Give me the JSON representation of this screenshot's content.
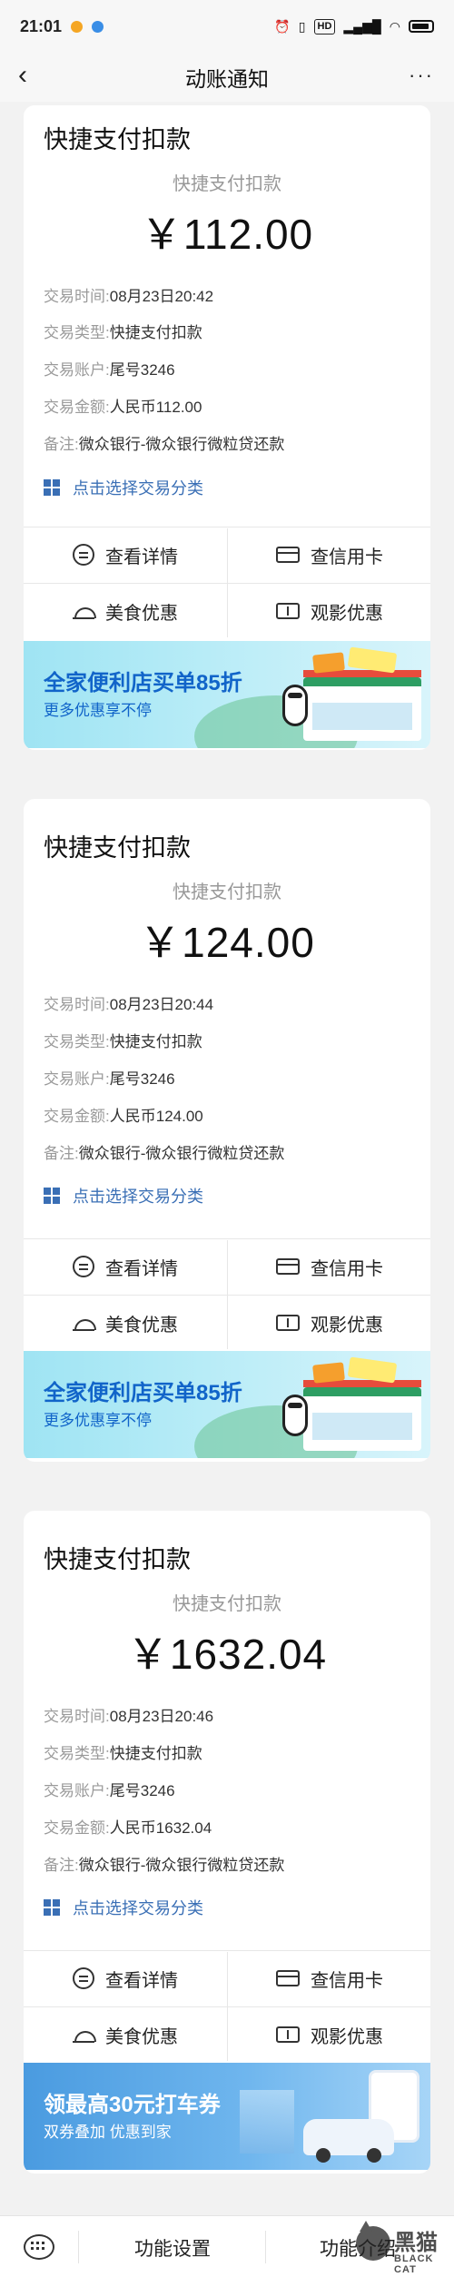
{
  "status_bar": {
    "time": "21:01",
    "icons": [
      "signal-icon",
      "wifi-icon",
      "battery-icon"
    ],
    "hd_label": "HD"
  },
  "nav": {
    "title": "动账通知",
    "back_icon": "‹",
    "more_icon": "···"
  },
  "labels": {
    "time": "交易时间:",
    "type": "交易类型:",
    "account": "交易账户:",
    "amount": "交易金额:",
    "remark": "备注:"
  },
  "cards": [
    {
      "title": "快捷支付扣款",
      "subtitle": "快捷支付扣款",
      "amount": "￥112.00",
      "time": "08月23日20:42",
      "type": "快捷支付扣款",
      "account": "尾号3246",
      "amount_detail": "人民币112.00",
      "remark": "微众银行-微众银行微粒贷还款",
      "classify": "点击选择交易分类",
      "actions": [
        "查看详情",
        "查信用卡",
        "美食优惠",
        "观影优惠"
      ],
      "banner": {
        "title": "全家便利店买单85折",
        "subtitle": "更多优惠享不停"
      }
    },
    {
      "title": "快捷支付扣款",
      "subtitle": "快捷支付扣款",
      "amount": "￥124.00",
      "time": "08月23日20:44",
      "type": "快捷支付扣款",
      "account": "尾号3246",
      "amount_detail": "人民币124.00",
      "remark": "微众银行-微众银行微粒贷还款",
      "classify": "点击选择交易分类",
      "actions": [
        "查看详情",
        "查信用卡",
        "美食优惠",
        "观影优惠"
      ],
      "banner": {
        "title": "全家便利店买单85折",
        "subtitle": "更多优惠享不停"
      }
    },
    {
      "title": "快捷支付扣款",
      "subtitle": "快捷支付扣款",
      "amount": "￥1632.04",
      "time": "08月23日20:46",
      "type": "快捷支付扣款",
      "account": "尾号3246",
      "amount_detail": "人民币1632.04",
      "remark": "微众银行-微众银行微粒贷还款",
      "classify": "点击选择交易分类",
      "actions": [
        "查看详情",
        "查信用卡",
        "美食优惠",
        "观影优惠"
      ],
      "banner": {
        "title": "领最高30元打车券",
        "subtitle": "双券叠加 优惠到家"
      }
    }
  ],
  "bottom_bar": {
    "settings": "功能设置",
    "intro": "功能介绍"
  },
  "watermark": {
    "cn": "黑猫",
    "en": "BLACK CAT"
  },
  "colors": {
    "accent": "#3a6fb5",
    "banner_text": "#1164c9",
    "page_bg": "#f2f2f2"
  }
}
